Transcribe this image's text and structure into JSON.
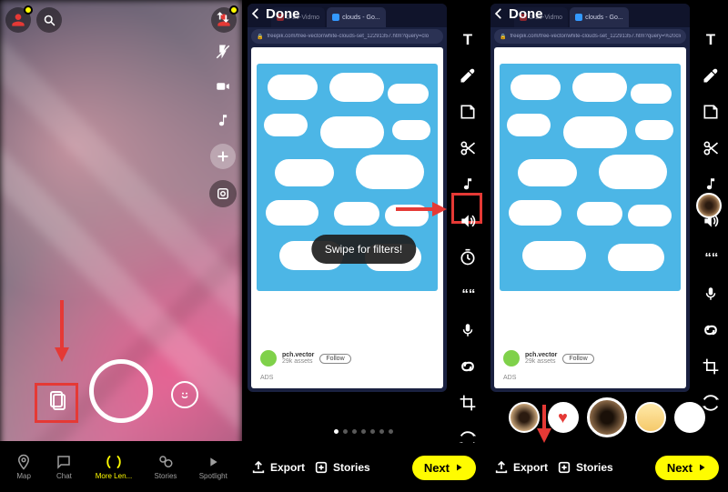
{
  "panel1": {
    "nav": [
      {
        "label": "Map"
      },
      {
        "label": "Chat"
      },
      {
        "label": "More Len..."
      },
      {
        "label": "Stories"
      },
      {
        "label": "Spotlight"
      }
    ]
  },
  "panel2": {
    "done": "Done",
    "tabs": {
      "t1": "2-20-Vidmo",
      "t2": "clouds - Go..."
    },
    "url": "freepik.com/free-vector/white-clouds-set_12291357.htm?query=clo",
    "hint": "Swipe for filters!",
    "vendor": {
      "name": "pch.vector",
      "followers": "29k assets",
      "follow": "Follow"
    },
    "ads": "ADS",
    "export": "Export",
    "stories": "Stories",
    "next": "Next"
  },
  "panel3": {
    "done": "Done",
    "tabs": {
      "t1": "2-20-Vidmo",
      "t2": "clouds - Go..."
    },
    "url": "freepik.com/free-vector/white-clouds-set_12291357.htm?query=%20clo",
    "vendor": {
      "name": "pch.vector",
      "followers": "29k assets",
      "follow": "Follow"
    },
    "ads": "ADS",
    "export": "Export",
    "stories": "Stories",
    "next": "Next"
  }
}
